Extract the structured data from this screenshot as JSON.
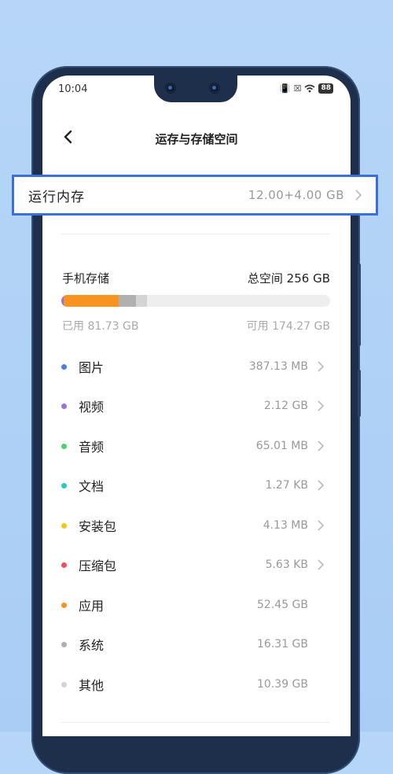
{
  "status_bar": {
    "time": "10:04",
    "battery": "88"
  },
  "header": {
    "title": "运存与存储空间"
  },
  "ram": {
    "label": "运行内存",
    "value": "12.00+4.00  GB"
  },
  "storage": {
    "label": "手机存储",
    "total": "总空间  256  GB",
    "used": "已用  81.73  GB",
    "free": "可用  174.27  GB"
  },
  "items": [
    {
      "label": "图片",
      "value": "387.13  MB",
      "color": "#4a7fe0",
      "has_chevron": true
    },
    {
      "label": "视频",
      "value": "2.12  GB",
      "color": "#9b6fe0",
      "has_chevron": true
    },
    {
      "label": "音频",
      "value": "65.01  MB",
      "color": "#4ccf73",
      "has_chevron": true
    },
    {
      "label": "文档",
      "value": "1.27  KB",
      "color": "#2bc6c6",
      "has_chevron": true
    },
    {
      "label": "安装包",
      "value": "4.13  MB",
      "color": "#f5c518",
      "has_chevron": true
    },
    {
      "label": "压缩包",
      "value": "5.63  KB",
      "color": "#ef4e5a",
      "has_chevron": true
    },
    {
      "label": "应用",
      "value": "52.45  GB",
      "color": "#f7931e",
      "has_chevron": false
    },
    {
      "label": "系统",
      "value": "16.31  GB",
      "color": "#b0b0b0",
      "has_chevron": false
    },
    {
      "label": "其他",
      "value": "10.39  GB",
      "color": "#d4d4d4",
      "has_chevron": false
    }
  ]
}
